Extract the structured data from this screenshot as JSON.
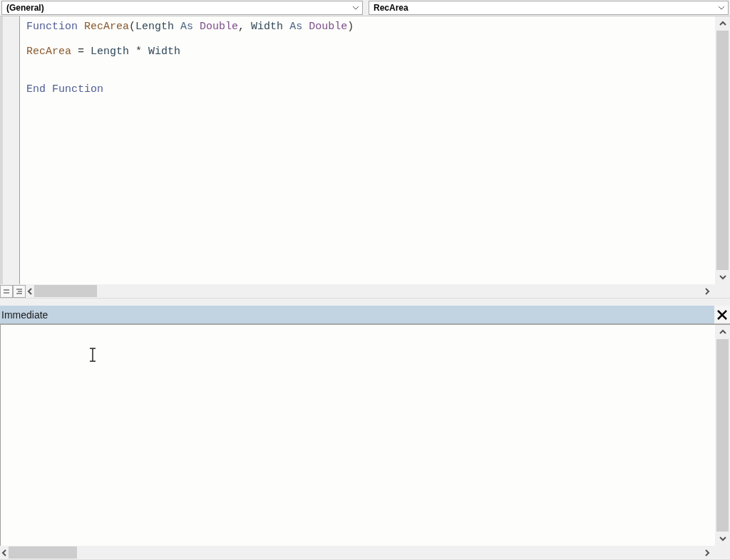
{
  "object_dropdown": {
    "value": "(General)"
  },
  "procedure_dropdown": {
    "value": "RecArea"
  },
  "code_lines": [
    {
      "kind": "code",
      "tokens": [
        {
          "text": "Function",
          "kind": "keyword"
        },
        {
          "text": " RecArea",
          "kind": "function"
        },
        {
          "text": "(",
          "kind": "plain"
        },
        {
          "text": "Length",
          "kind": "variable"
        },
        {
          "text": " As",
          "kind": "as"
        },
        {
          "text": " Double",
          "kind": "type"
        },
        {
          "text": ", ",
          "kind": "plain"
        },
        {
          "text": "Width",
          "kind": "variable"
        },
        {
          "text": " As",
          "kind": "as"
        },
        {
          "text": " Double",
          "kind": "type"
        },
        {
          "text": ")",
          "kind": "plain"
        }
      ]
    },
    {
      "kind": "blank"
    },
    {
      "kind": "code",
      "tokens": [
        {
          "text": "RecArea",
          "kind": "function"
        },
        {
          "text": " = ",
          "kind": "plain"
        },
        {
          "text": "Length",
          "kind": "variable"
        },
        {
          "text": " * ",
          "kind": "plain"
        },
        {
          "text": "Width",
          "kind": "variable"
        }
      ]
    },
    {
      "kind": "blank"
    },
    {
      "kind": "blank"
    },
    {
      "kind": "code",
      "tokens": [
        {
          "text": "End",
          "kind": "keyword"
        },
        {
          "text": " Function",
          "kind": "keyword"
        }
      ]
    }
  ],
  "immediate": {
    "title": "Immediate"
  }
}
